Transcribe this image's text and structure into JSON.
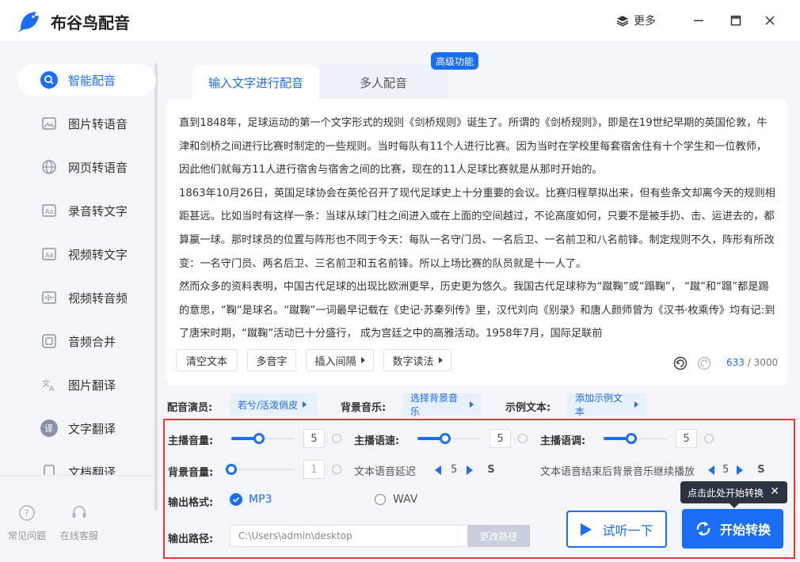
{
  "app": {
    "title": "布谷鸟配音",
    "more_label": "更多",
    "brand_color": "#1a6df5"
  },
  "sidebar": {
    "items": [
      {
        "label": "智能配音",
        "icon": "mic-icon",
        "active": true
      },
      {
        "label": "图片转语音",
        "icon": "image-icon"
      },
      {
        "label": "网页转语音",
        "icon": "globe-icon"
      },
      {
        "label": "录音转文字",
        "icon": "text-aa-icon"
      },
      {
        "label": "视频转文字",
        "icon": "video-text-icon"
      },
      {
        "label": "视频转音频",
        "icon": "waveform-icon"
      },
      {
        "label": "音频合并",
        "icon": "merge-icon"
      },
      {
        "label": "图片翻译",
        "icon": "translate-icon"
      },
      {
        "label": "文字翻译",
        "icon": "translate-bubble-icon"
      },
      {
        "label": "文档翻译",
        "icon": "document-icon"
      }
    ],
    "bottom": [
      {
        "label": "常见问题",
        "icon": "question-icon"
      },
      {
        "label": "在线客服",
        "icon": "headset-icon"
      }
    ]
  },
  "tabs": [
    {
      "label": "输入文字进行配音",
      "active": true
    },
    {
      "label": "多人配音"
    }
  ],
  "advanced_badge": "高级功能",
  "editor": {
    "paragraphs": [
      "直到1848年，足球运动的第一个文字形式的规则《剑桥规则》诞生了。所谓的《剑桥规则》，即是在19世纪早期的英国伦敦，牛津和剑桥之间进行比赛时制定的一些规则。当时每队有11个人进行比赛。因为当时在学校里每套宿舍住有十个学生和一位教师，因此他们就每方11人进行宿舍与宿舍之间的比赛，现在的11人足球比赛就是从那时开始的。",
      "1863年10月26日，英国足球协会在英伦召开了现代足球史上十分重要的会议。比赛归程草拟出来，但有些条文却离今天的规则相距甚远。比如当时有这样一条：当球从球门柱之间进入或在上面的空间越过，不论高度如何，只要不是被手扔、击、运进去的，都算赢一球。那时球员的位置与阵形也不同于今天：每队一名守门员、一名后卫、一名前卫和八名前锋。制定规则不久，阵形有所改变：一名守门员、两名后卫、三名前卫和五名前锋。所以上场比赛的队员就是十一人了。",
      "然而众多的资料表明，中国古代足球的出现比欧洲更早，历史更为悠久。我国古代足球称为“蹴鞠”或“蹋鞠”， “蹴”和“蹋”都是踢的意思，“鞠”是球名。“蹴鞠”一词最早记载在《史记·苏秦列传》里，汉代刘向《别录》和唐人颜师曾为《汉书·枚乘传》均有记:到了唐宋时期，“蹴鞠”活动已十分盛行， 成为宫廷之中的高雅活动。1958年7月，国际足联前"
    ],
    "tools": {
      "clear": "清空文本",
      "polyphone": "多音字",
      "insert_pause": "插入间隔",
      "number_reading": "数字读法"
    },
    "count": "633",
    "count_max": "/ 3000"
  },
  "voice_row": {
    "actor_label": "配音演员:",
    "actor_value": "若兮/活泼俏皮",
    "bgm_label": "背景音乐:",
    "bgm_value": "选择背景音乐",
    "sample_label": "示例文本:",
    "sample_value": "添加示例文本"
  },
  "controls": {
    "host_volume": {
      "label": "主播音量:",
      "value": "5",
      "fraction": 0.42
    },
    "host_speed": {
      "label": "主播语速:",
      "value": "5",
      "fraction": 0.42
    },
    "host_pitch": {
      "label": "主播语调:",
      "value": "5",
      "fraction": 0.42
    },
    "bg_volume": {
      "label": "背景音量:",
      "value": "1",
      "fraction": 0.0
    },
    "delay": {
      "label": "文本语音延迟",
      "value": "5",
      "unit": "S"
    },
    "continue_bgm": {
      "label": "文本语音结束后背景音乐继续播放",
      "value": "5",
      "unit": "S"
    },
    "format": {
      "label": "输出格式:",
      "options": [
        "MP3",
        "WAV"
      ],
      "selected": "MP3"
    },
    "path": {
      "label": "输出路径:",
      "value": "C:\\Users\\admin\\desktop",
      "change_label": "更改路径"
    }
  },
  "actions": {
    "listen": "试听一下",
    "start": "开始转换",
    "tooltip": "点击此处开始转换"
  }
}
